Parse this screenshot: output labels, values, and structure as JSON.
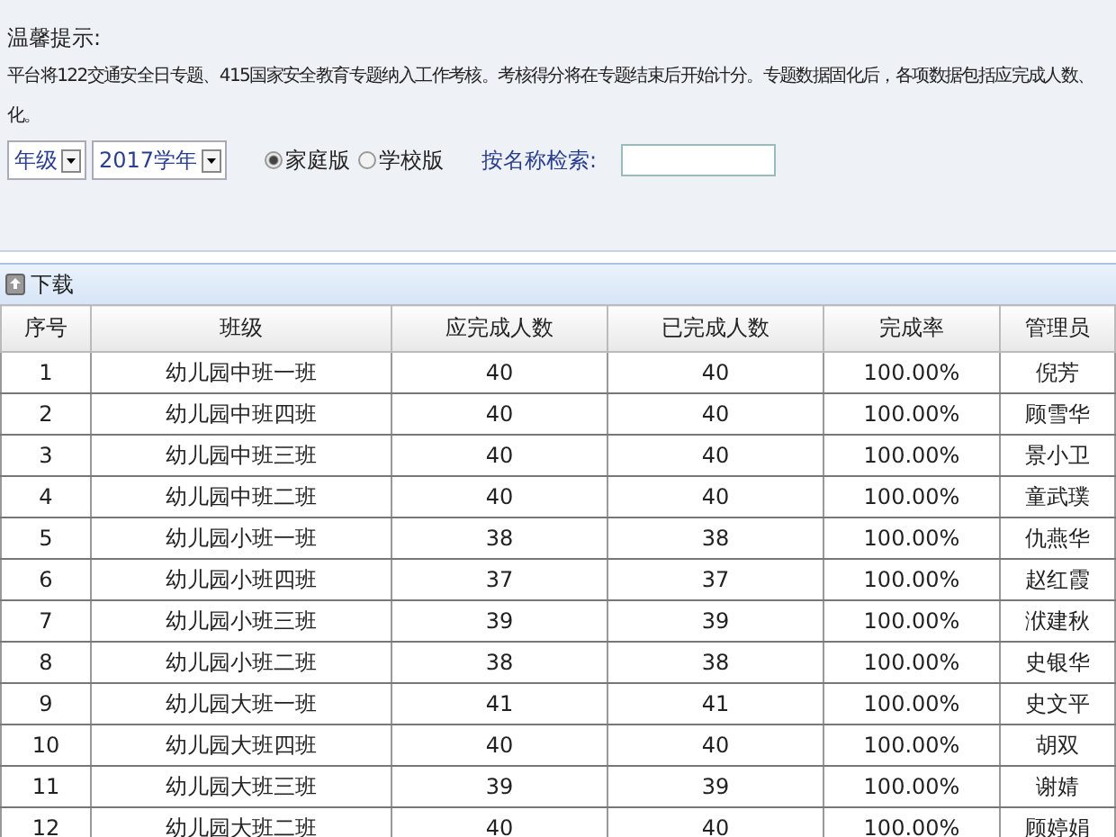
{
  "notice": {
    "title": "温馨提示:",
    "lines": [
      "平台将122交通安全日专题、415国家安全教育专题纳入工作考核。考核得分将在专题结束后开始计分。专题数据固化后，各项数据包括应完成人数、",
      "化。"
    ]
  },
  "filters": {
    "grade": "年级",
    "year": "2017学年",
    "radios": [
      {
        "label": "家庭版",
        "selected": true
      },
      {
        "label": "学校版",
        "selected": false
      }
    ],
    "search_label": "按名称检索:"
  },
  "toolbar": {
    "download": "下载"
  },
  "table": {
    "columns": [
      "序号",
      "班级",
      "应完成人数",
      "已完成人数",
      "完成率",
      "管理员"
    ],
    "rows": [
      [
        "1",
        "幼儿园中班一班",
        "40",
        "40",
        "100.00%",
        "倪芳"
      ],
      [
        "2",
        "幼儿园中班四班",
        "40",
        "40",
        "100.00%",
        "顾雪华"
      ],
      [
        "3",
        "幼儿园中班三班",
        "40",
        "40",
        "100.00%",
        "景小卫"
      ],
      [
        "4",
        "幼儿园中班二班",
        "40",
        "40",
        "100.00%",
        "童武璞"
      ],
      [
        "5",
        "幼儿园小班一班",
        "38",
        "38",
        "100.00%",
        "仇燕华"
      ],
      [
        "6",
        "幼儿园小班四班",
        "37",
        "37",
        "100.00%",
        "赵红霞"
      ],
      [
        "7",
        "幼儿园小班三班",
        "39",
        "39",
        "100.00%",
        "洑建秋"
      ],
      [
        "8",
        "幼儿园小班二班",
        "38",
        "38",
        "100.00%",
        "史银华"
      ],
      [
        "9",
        "幼儿园大班一班",
        "41",
        "41",
        "100.00%",
        "史文平"
      ],
      [
        "10",
        "幼儿园大班四班",
        "40",
        "40",
        "100.00%",
        "胡双"
      ],
      [
        "11",
        "幼儿园大班三班",
        "39",
        "39",
        "100.00%",
        "谢婧"
      ],
      [
        "12",
        "幼儿园大班二班",
        "40",
        "40",
        "100.00%",
        "顾婷娟"
      ]
    ]
  }
}
